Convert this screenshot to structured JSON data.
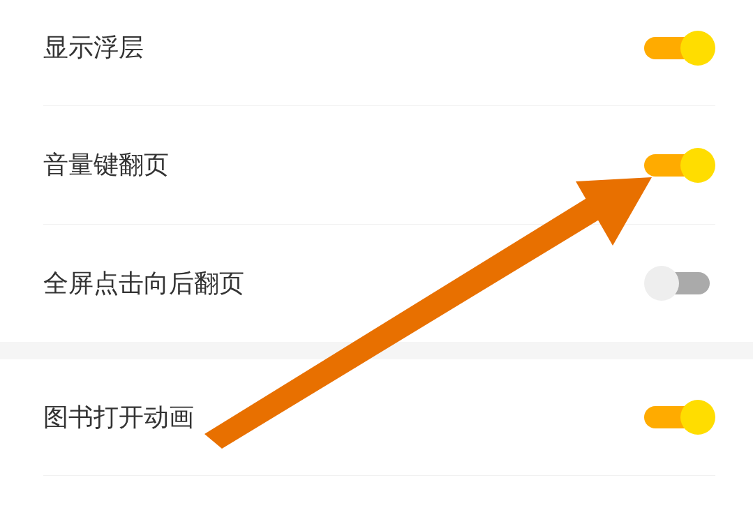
{
  "sections": [
    {
      "rows": [
        {
          "label": "显示浮层",
          "on": true
        },
        {
          "label": "音量键翻页",
          "on": true
        },
        {
          "label": "全屏点击向后翻页",
          "on": false
        }
      ]
    },
    {
      "rows": [
        {
          "label": "图书打开动画",
          "on": true
        }
      ]
    }
  ]
}
